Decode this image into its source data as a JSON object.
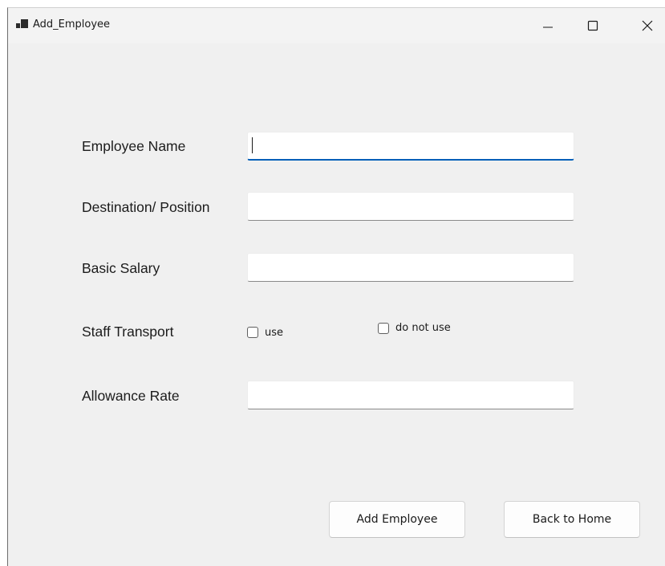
{
  "window": {
    "title": "Add_Employee",
    "icons": {
      "app": "app-window-icon",
      "minimize": "minimize-icon",
      "maximize": "maximize-icon",
      "close": "close-icon"
    }
  },
  "form": {
    "employee_name": {
      "label": "Employee Name",
      "value": ""
    },
    "designation": {
      "label": "Destination/ Position",
      "value": ""
    },
    "basic_salary": {
      "label": "Basic Salary",
      "value": ""
    },
    "staff_transport": {
      "label": "Staff Transport",
      "options": [
        {
          "label": "use",
          "checked": false
        },
        {
          "label": "do not use",
          "checked": false
        }
      ]
    },
    "allowance_rate": {
      "label": "Allowance Rate",
      "value": ""
    }
  },
  "buttons": {
    "add": "Add Employee",
    "back": "Back to Home"
  },
  "colors": {
    "focus_accent": "#005fb8",
    "background": "#f0f0f0"
  }
}
